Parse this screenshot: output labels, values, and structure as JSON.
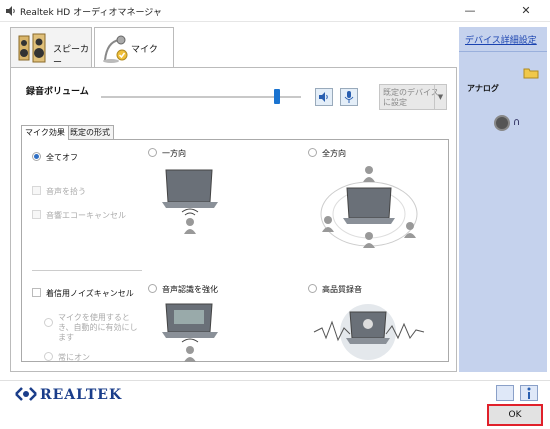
{
  "window": {
    "title": "Realtek HD オーディオマネージャ",
    "minimize": "—",
    "close": "✕"
  },
  "tabs": [
    {
      "label": "スピーカー"
    },
    {
      "label": "マイク"
    }
  ],
  "recording": {
    "volume_label": "録音ボリューム",
    "volume_level": 0.88,
    "default_device_text": "既定のデバイスに設定"
  },
  "inner_tabs": [
    {
      "label": "マイク効果"
    },
    {
      "label": "既定の形式"
    }
  ],
  "effects": {
    "all_off": "全てオフ",
    "pick_up_voice": "音声を拾う",
    "echo_cancel": "音響エコーキャンセル",
    "noise_cancel": "着信用ノイズキャンセル",
    "auto_enable": "マイクを使用するとき、自動的に有効にします",
    "always_on": "常にオン",
    "one_direction": "一方向",
    "all_direction": "全方向",
    "voice_enhance": "音声認識を強化",
    "high_quality": "高品質録音"
  },
  "side": {
    "advanced_link": "デバイス詳細設定",
    "analog_label": "アナログ"
  },
  "footer": {
    "brand": "REALTEK",
    "ok": "OK"
  },
  "colors": {
    "accent": "#1a73d0",
    "side_panel": "#c5d2ed",
    "link": "#1a43b0",
    "ok_highlight": "#e0202a"
  }
}
